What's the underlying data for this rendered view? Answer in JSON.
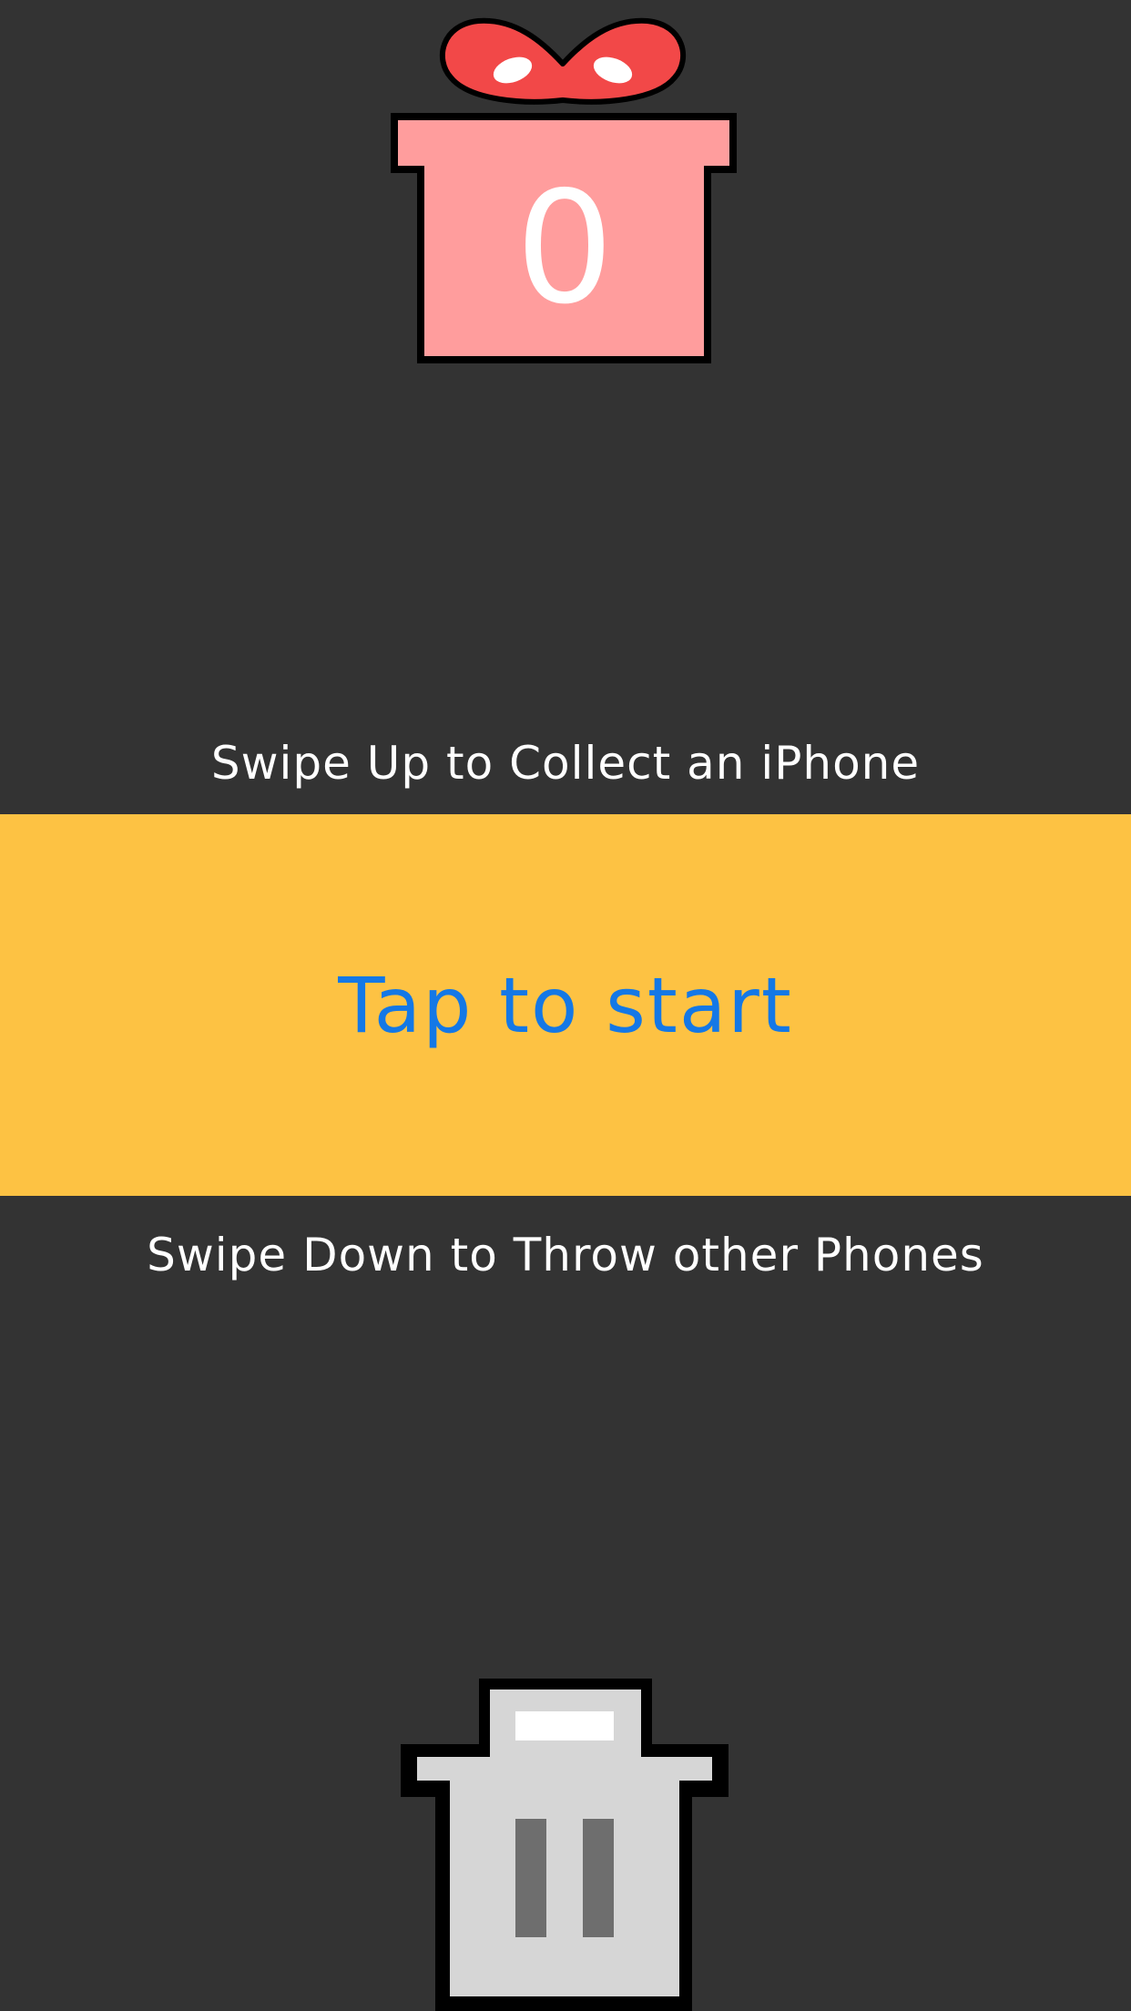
{
  "score": {
    "value": "0",
    "icon": "gift-icon"
  },
  "hints": {
    "swipe_up": "Swipe Up to Collect an iPhone",
    "swipe_down": "Swipe Down to Throw other Phones"
  },
  "start": {
    "label": "Tap to start"
  },
  "trash": {
    "icon": "trash-icon"
  },
  "colors": {
    "background": "#333333",
    "gift_box": "#ff9d9d",
    "gift_ribbon": "#f24848",
    "start_band": "#fdc243",
    "start_text": "#1478e6",
    "trash_fill": "#d6d6d6",
    "trash_slots": "#6e6e6e"
  }
}
